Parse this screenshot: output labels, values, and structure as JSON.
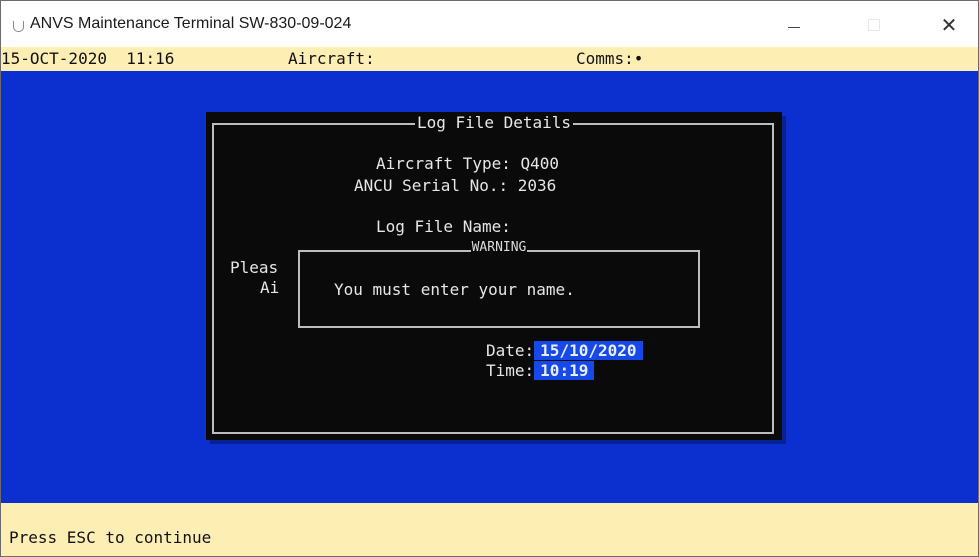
{
  "window": {
    "title": "ANVS Maintenance Terminal SW-830-09-024",
    "minimize_icon": "minimize-icon",
    "maximize_icon": "maximize-icon",
    "close_glyph": "✕"
  },
  "status": {
    "datetime": "15-OCT-2020  11:16",
    "aircraft_label": "Aircraft:",
    "comms_label": "Comms:•"
  },
  "dialog": {
    "title": "Log File Details",
    "aircraft_type_label": "Aircraft Type: ",
    "aircraft_type_value": "Q400",
    "ancu_serial_label": "ANCU Serial No.: ",
    "ancu_serial_value": "2036",
    "log_file_name_label": "Log File Name:",
    "please_partial": "Pleas",
    "ai_partial": "Ai",
    "date_label": "Date:",
    "date_value": "15/10/2020",
    "time_label": "Time:",
    "time_value": "10:19"
  },
  "warning": {
    "title": "WARNING",
    "message": "You must enter your name."
  },
  "footer": {
    "hint": "Press ESC to continue"
  },
  "colors": {
    "terminal_blue": "#0c2fcf",
    "status_bar": "#fdeeb4",
    "dialog_bg": "#0a0a0a",
    "field_highlight": "#1749e8"
  }
}
